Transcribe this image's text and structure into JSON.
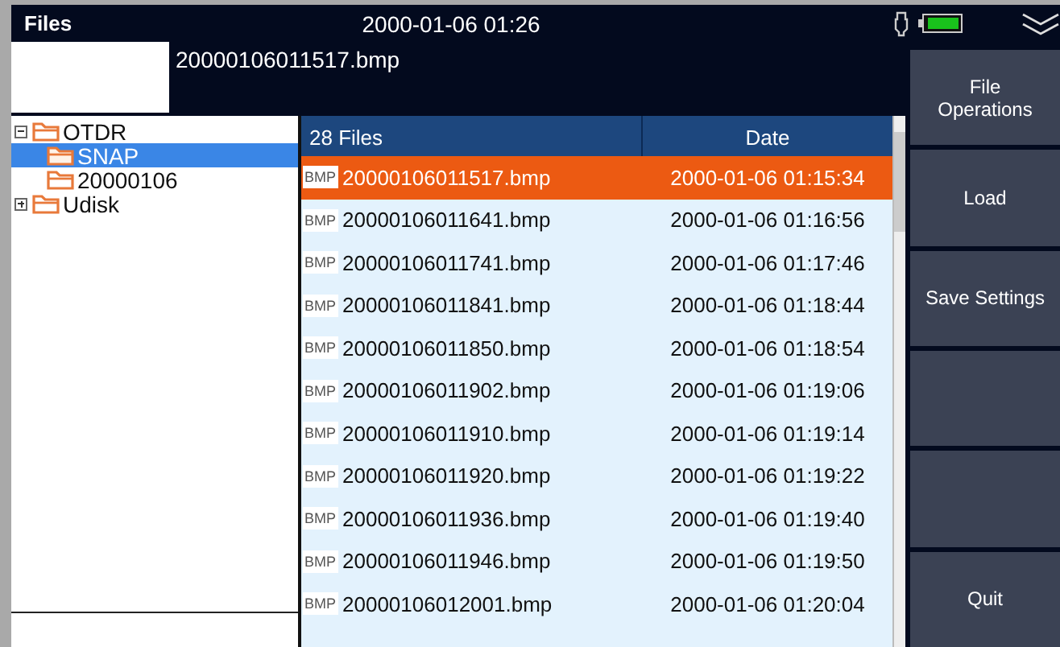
{
  "window": {
    "title": "Files",
    "datetime": "2000-01-06 01:26"
  },
  "preview": {
    "filename": "20000106011517.bmp"
  },
  "tree": [
    {
      "label": "OTDR",
      "expanded": true,
      "selected": false,
      "children": [
        {
          "label": "SNAP",
          "selected": true
        },
        {
          "label": "20000106",
          "selected": false
        }
      ]
    },
    {
      "label": "Udisk",
      "expanded": false,
      "selected": false
    }
  ],
  "table": {
    "columns": [
      "28 Files",
      "Date"
    ],
    "rows": [
      {
        "type": "BMP",
        "name": "20000106011517.bmp",
        "date": "2000-01-06 01:15:34",
        "selected": true
      },
      {
        "type": "BMP",
        "name": "20000106011641.bmp",
        "date": "2000-01-06 01:16:56",
        "selected": false
      },
      {
        "type": "BMP",
        "name": "20000106011741.bmp",
        "date": "2000-01-06 01:17:46",
        "selected": false
      },
      {
        "type": "BMP",
        "name": "20000106011841.bmp",
        "date": "2000-01-06 01:18:44",
        "selected": false
      },
      {
        "type": "BMP",
        "name": "20000106011850.bmp",
        "date": "2000-01-06 01:18:54",
        "selected": false
      },
      {
        "type": "BMP",
        "name": "20000106011902.bmp",
        "date": "2000-01-06 01:19:06",
        "selected": false
      },
      {
        "type": "BMP",
        "name": "20000106011910.bmp",
        "date": "2000-01-06 01:19:14",
        "selected": false
      },
      {
        "type": "BMP",
        "name": "20000106011920.bmp",
        "date": "2000-01-06 01:19:22",
        "selected": false
      },
      {
        "type": "BMP",
        "name": "20000106011936.bmp",
        "date": "2000-01-06 01:19:40",
        "selected": false
      },
      {
        "type": "BMP",
        "name": "20000106011946.bmp",
        "date": "2000-01-06 01:19:50",
        "selected": false
      },
      {
        "type": "BMP",
        "name": "20000106012001.bmp",
        "date": "2000-01-06 01:20:04",
        "selected": false
      }
    ]
  },
  "buttons": [
    {
      "kind": "text",
      "label": "File Operations"
    },
    {
      "kind": "text",
      "label": "Load"
    },
    {
      "kind": "text",
      "label": "Save Settings"
    },
    {
      "kind": "blank"
    },
    {
      "kind": "blank"
    },
    {
      "kind": "text",
      "label": "Quit"
    }
  ]
}
